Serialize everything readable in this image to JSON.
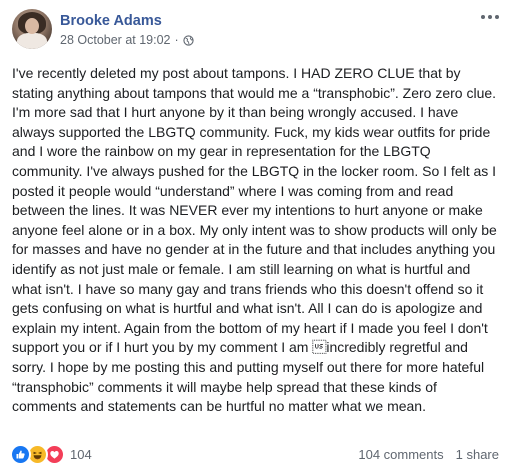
{
  "post": {
    "author": "Brooke Adams",
    "timestamp": "28 October at 19:02",
    "separator": "·",
    "privacy_icon": "globe-icon",
    "more_icon": "ellipsis-icon",
    "text": "I've recently deleted my post about tampons. I HAD ZERO CLUE that by stating anything about tampons that would me a “transphobic”. Zero zero clue. I'm more sad that I hurt anyone by it than being wrongly accused. I have always supported the LBGTQ community. Fuck, my kids wear outfits for pride and I wore the rainbow on my gear in representation for the LBGTQ community. I've always pushed for the LBGTQ in the locker room. So I felt as I posted it people would “understand” where I was coming from and read between the lines. It was NEVER ever my intentions to hurt anyone or make anyone feel alone or in a box. My only intent was to show products will only be for masses and have no gender at in the future and that includes anything you identify as not just male or female. I am still learning on what is hurtful and what isn't. I have so many gay and trans friends who this doesn't offend so it gets confusing on what is hurtful and what isn't. All I can do is apologize and explain my intent. Again from the bottom of my heart if I made you feel I don't support you or if I hurt you by my comment I am \u001fincredibly regretful and sorry. I hope by me posting this and putting myself out there for more hateful “transphobic” comments it will maybe help spread that these kinds of comments and statements can be hurtful no matter what we mean."
  },
  "footer": {
    "reactions": [
      "like-icon",
      "haha-icon",
      "love-icon"
    ],
    "reaction_count": "104",
    "comments": "104 comments",
    "shares": "1 share"
  },
  "colors": {
    "link": "#385898",
    "like": "#1877f2",
    "haha": "#f7b928",
    "love": "#f33e58",
    "muted": "#606770"
  }
}
